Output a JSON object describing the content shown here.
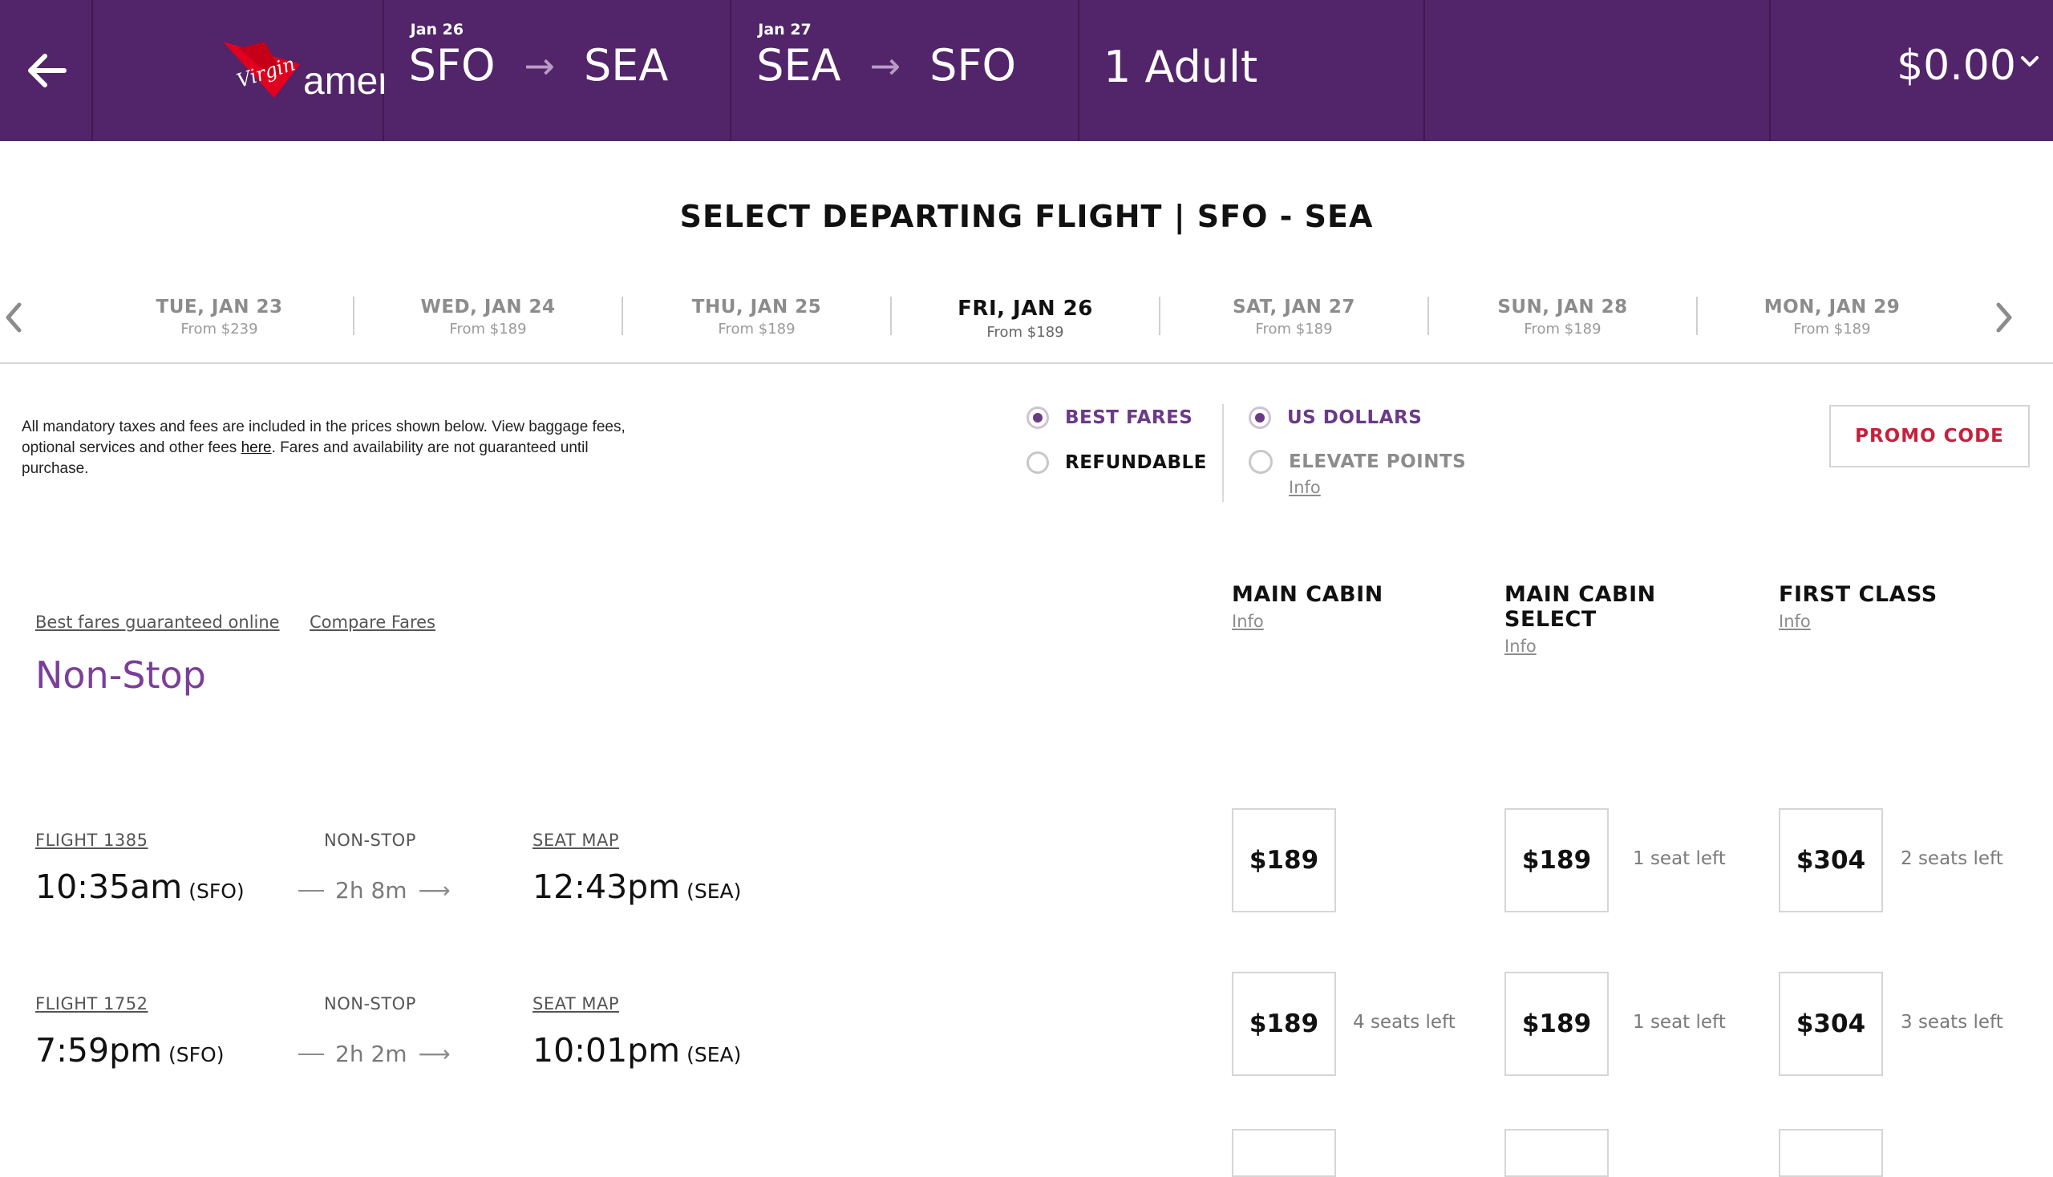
{
  "header": {
    "brand": {
      "word1": "Virgin",
      "word2": "america"
    },
    "outbound": {
      "date": "Jan 26",
      "from": "SFO",
      "to": "SEA"
    },
    "return": {
      "date": "Jan 27",
      "from": "SEA",
      "to": "SFO"
    },
    "passengers": "1 Adult",
    "total": "$0.00"
  },
  "page_title": "SELECT DEPARTING FLIGHT | SFO - SEA",
  "date_strip": [
    {
      "day": "TUE, JAN 23",
      "from": "From $239",
      "active": false
    },
    {
      "day": "WED, JAN 24",
      "from": "From $189",
      "active": false
    },
    {
      "day": "THU, JAN 25",
      "from": "From $189",
      "active": false
    },
    {
      "day": "FRI, JAN 26",
      "from": "From $189",
      "active": true
    },
    {
      "day": "SAT, JAN 27",
      "from": "From $189",
      "active": false
    },
    {
      "day": "SUN, JAN 28",
      "from": "From $189",
      "active": false
    },
    {
      "day": "MON, JAN 29",
      "from": "From $189",
      "active": false
    }
  ],
  "disclaimer": {
    "before": "All mandatory taxes and fees are included in the prices shown below. View baggage fees, optional services and other fees ",
    "link": "here",
    "after": ". Fares and availability are not guaranteed until purchase."
  },
  "fare_options": {
    "best_fares": "BEST FARES",
    "refundable": "REFUNDABLE",
    "us_dollars": "US DOLLARS",
    "elevate_points": "ELEVATE POINTS",
    "info": "Info",
    "selected_fare": "best_fares",
    "selected_currency": "us_dollars"
  },
  "promo_code": "PROMO CODE",
  "cabins": [
    {
      "name": "MAIN CABIN",
      "info": "Info"
    },
    {
      "name": "MAIN CABIN SELECT",
      "info": "Info"
    },
    {
      "name": "FIRST CLASS",
      "info": "Info"
    }
  ],
  "links": {
    "best_fares_guaranteed": "Best fares guaranteed online",
    "compare_fares": "Compare Fares"
  },
  "section_title": "Non-Stop",
  "flights": [
    {
      "flight": "FLIGHT 1385",
      "stops": "NON-STOP",
      "seat_map": "SEAT MAP",
      "depart": "10:35am",
      "depart_code": "(SFO)",
      "duration": "2h 8m",
      "arrive": "12:43pm",
      "arrive_code": "(SEA)",
      "fares": [
        {
          "price": "$189",
          "seats": ""
        },
        {
          "price": "$189",
          "seats": "1 seat left"
        },
        {
          "price": "$304",
          "seats": "2 seats left"
        }
      ]
    },
    {
      "flight": "FLIGHT 1752",
      "stops": "NON-STOP",
      "seat_map": "SEAT MAP",
      "depart": "7:59pm",
      "depart_code": "(SFO)",
      "duration": "2h 2m",
      "arrive": "10:01pm",
      "arrive_code": "(SEA)",
      "fares": [
        {
          "price": "$189",
          "seats": "4 seats left"
        },
        {
          "price": "$189",
          "seats": "1 seat left"
        },
        {
          "price": "$304",
          "seats": "3 seats left"
        }
      ]
    }
  ],
  "colors": {
    "header_bg": "#522469",
    "accent_purple": "#7b3f99",
    "promo_red": "#c6203b",
    "logo_red": "#e1001e"
  }
}
